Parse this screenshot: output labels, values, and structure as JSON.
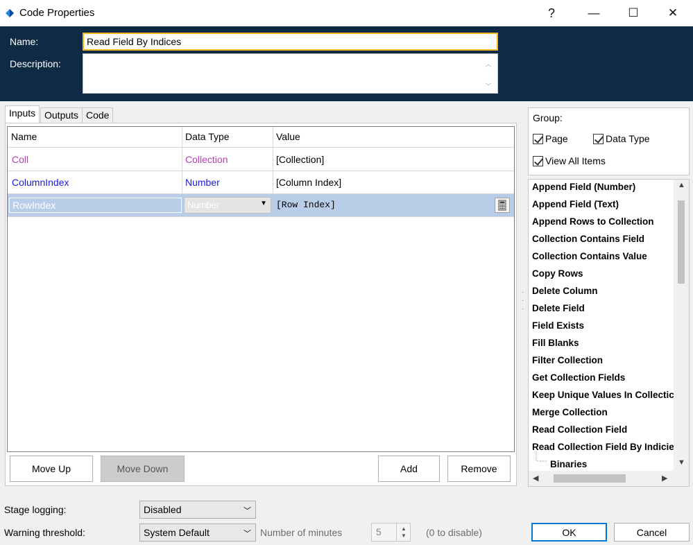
{
  "window": {
    "title": "Code Properties",
    "help_label": "?",
    "minimize_label": "—",
    "maximize_label": "☐",
    "close_label": "✕"
  },
  "header": {
    "name_label": "Name:",
    "name_value": "Read Field By Indices",
    "description_label": "Description:",
    "description_value": ""
  },
  "tabs": [
    {
      "label": "Inputs",
      "active": true
    },
    {
      "label": "Outputs",
      "active": false
    },
    {
      "label": "Code",
      "active": false
    }
  ],
  "grid": {
    "columns": [
      "Name",
      "Data Type",
      "Value"
    ],
    "rows": [
      {
        "name": "Coll",
        "type": "Collection",
        "value": "[Collection]",
        "color": "#b33fb3"
      },
      {
        "name": "ColumnIndex",
        "type": "Number",
        "value": "[Column Index]",
        "color": "#1a1adb"
      },
      {
        "name": "RowIndex",
        "type": "Number",
        "value": "[Row Index]",
        "color": "#ffffff",
        "selected": true
      }
    ]
  },
  "grid_buttons": {
    "move_up": "Move Up",
    "move_down": "Move Down",
    "add": "Add",
    "remove": "Remove"
  },
  "group": {
    "label": "Group:",
    "page": {
      "label": "Page",
      "checked": true
    },
    "data_type": {
      "label": "Data Type",
      "checked": true
    },
    "view_all": {
      "label": "View All Items",
      "checked": true
    }
  },
  "item_list": [
    "Append Field (Number)",
    "Append Field (Text)",
    "Append Rows to Collection",
    "Collection Contains Field",
    "Collection Contains Value",
    "Copy Rows",
    "Delete Column",
    "Delete Field",
    "Field Exists",
    "Fill Blanks",
    "Filter Collection",
    "Get Collection Fields",
    "Keep Unique Values In Collectic",
    "Merge Collection",
    "Read Collection Field",
    "Read Collection Field By Indicie",
    "Binaries"
  ],
  "bottom": {
    "stage_logging_label": "Stage logging:",
    "stage_logging_value": "Disabled",
    "warning_label": "Warning threshold:",
    "warning_value": "System Default",
    "minutes_label": "Number of minutes",
    "minutes_value": "5",
    "disable_hint": "(0 to disable)",
    "ok": "OK",
    "cancel": "Cancel"
  },
  "colors": {
    "header_bg": "#0e2a45",
    "focus_border": "#f2b822",
    "selection": "#b8cde8",
    "ok_border": "#0078d7"
  }
}
